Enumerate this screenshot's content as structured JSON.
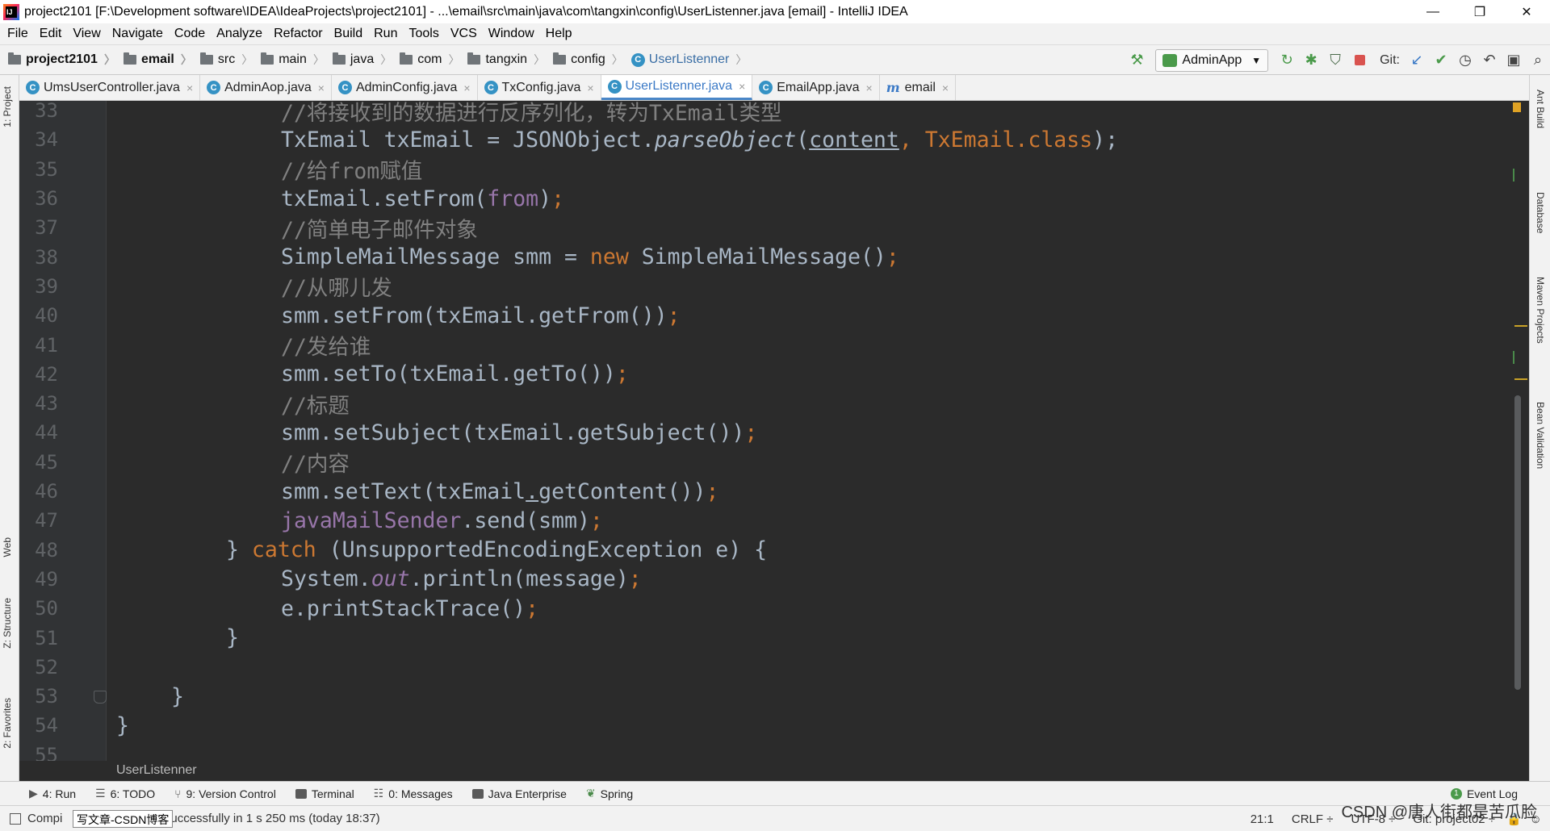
{
  "window": {
    "title": "project2101 [F:\\Development software\\IDEA\\IdeaProjects\\project2101] - ...\\email\\src\\main\\java\\com\\tangxin\\config\\UserListenner.java [email] - IntelliJ IDEA",
    "minimize": "—",
    "maximize": "❐",
    "close": "✕"
  },
  "menu": [
    "File",
    "Edit",
    "View",
    "Navigate",
    "Code",
    "Analyze",
    "Refactor",
    "Build",
    "Run",
    "Tools",
    "VCS",
    "Window",
    "Help"
  ],
  "nav": {
    "crumbs": [
      "project2101",
      "email",
      "src",
      "main",
      "java",
      "com",
      "tangxin",
      "config"
    ],
    "current": "UserListenner",
    "run_config": "AdminApp",
    "git_label": "Git:"
  },
  "tabs": [
    {
      "label": "UmsUserController.java",
      "icon": "C"
    },
    {
      "label": "AdminAop.java",
      "icon": "C"
    },
    {
      "label": "AdminConfig.java",
      "icon": "C"
    },
    {
      "label": "TxConfig.java",
      "icon": "C"
    },
    {
      "label": "UserListenner.java",
      "icon": "C"
    },
    {
      "label": "EmailApp.java",
      "icon": "C"
    },
    {
      "label": "email",
      "icon": "m"
    }
  ],
  "tab_close": "×",
  "left_tools": {
    "project": "1: Project",
    "web": "Web",
    "structure": "Z: Structure",
    "favorites": "2: Favorites"
  },
  "right_tools": {
    "ant": "Ant Build",
    "database": "Database",
    "maven": "Maven Projects",
    "bean": "Bean Validation"
  },
  "code": {
    "line_numbers": [
      "33",
      "34",
      "35",
      "36",
      "37",
      "38",
      "39",
      "40",
      "41",
      "42",
      "43",
      "44",
      "45",
      "46",
      "47",
      "48",
      "49",
      "50",
      "51",
      "52",
      "53",
      "54",
      "55"
    ],
    "l33": "//将接收到的数据进行反序列化，转为TxEmail类型",
    "l34a": "TxEmail txEmail = JSONObject.",
    "l34b": "parseObject",
    "l34c": "(",
    "l34d": "content",
    "l34e": ", TxEmail.",
    "l34f": "class",
    "l34g": ");",
    "l34h": ";",
    "l35": "//给from赋值",
    "l36a": "txEmail.setFrom(",
    "l36b": "from",
    "l36c": ")",
    "l36d": ";",
    "l37": "//简单电子邮件对象",
    "l38a": "SimpleMailMessage smm = ",
    "l38b": "new",
    "l38c": " SimpleMailMessage()",
    "l38d": ";",
    "l39": "//从哪儿发",
    "l40a": "smm.setFrom(txEmail.getFrom())",
    "l40b": ";",
    "l41": "//发给谁",
    "l42a": "smm.setTo(txEmail.getTo())",
    "l42b": ";",
    "l43": "//标题",
    "l44a": "smm.setSubject(txEmail.getSubject())",
    "l44b": ";",
    "l45": "//内容",
    "l46a": "smm.setText(txEmail",
    "l46b": ".",
    "l46c": "getContent())",
    "l46d": ";",
    "l47a": "javaMailSender",
    "l47b": ".send(smm)",
    "l47c": ";",
    "l48a": "} ",
    "l48b": "catch",
    "l48c": " (UnsupportedEncodingException e) {",
    "l49a": "System.",
    "l49b": "out",
    "l49c": ".println(message)",
    "l49d": ";",
    "l50a": "e.printStackTrace()",
    "l50b": ";",
    "l51": "}",
    "l53": "}",
    "l54": "}"
  },
  "editor_breadcrumb": "UserListenner",
  "tool_windows": [
    {
      "label": "4: Run"
    },
    {
      "label": "6: TODO"
    },
    {
      "label": "9: Version Control"
    },
    {
      "label": "Terminal"
    },
    {
      "label": "0: Messages"
    },
    {
      "label": "Java Enterprise"
    },
    {
      "label": "Spring"
    }
  ],
  "event_log": {
    "count": "1",
    "label": "Event Log"
  },
  "status": {
    "message_start": "Compi",
    "tooltip": "写文章-CSDN博客",
    "message_end": "uccessfully in 1 s 250 ms (today 18:37)",
    "position": "21:1",
    "line_sep": "CRLF ÷",
    "encoding": "UTF-8 ÷",
    "git": "Git: project02 ÷"
  },
  "watermark": "CSDN @唐人街都是苦瓜脸",
  "colors": {
    "keyword": "#cc7832",
    "comment": "#808080",
    "field": "#9876aa",
    "text": "#a9b7c6",
    "background": "#2b2b2b"
  }
}
